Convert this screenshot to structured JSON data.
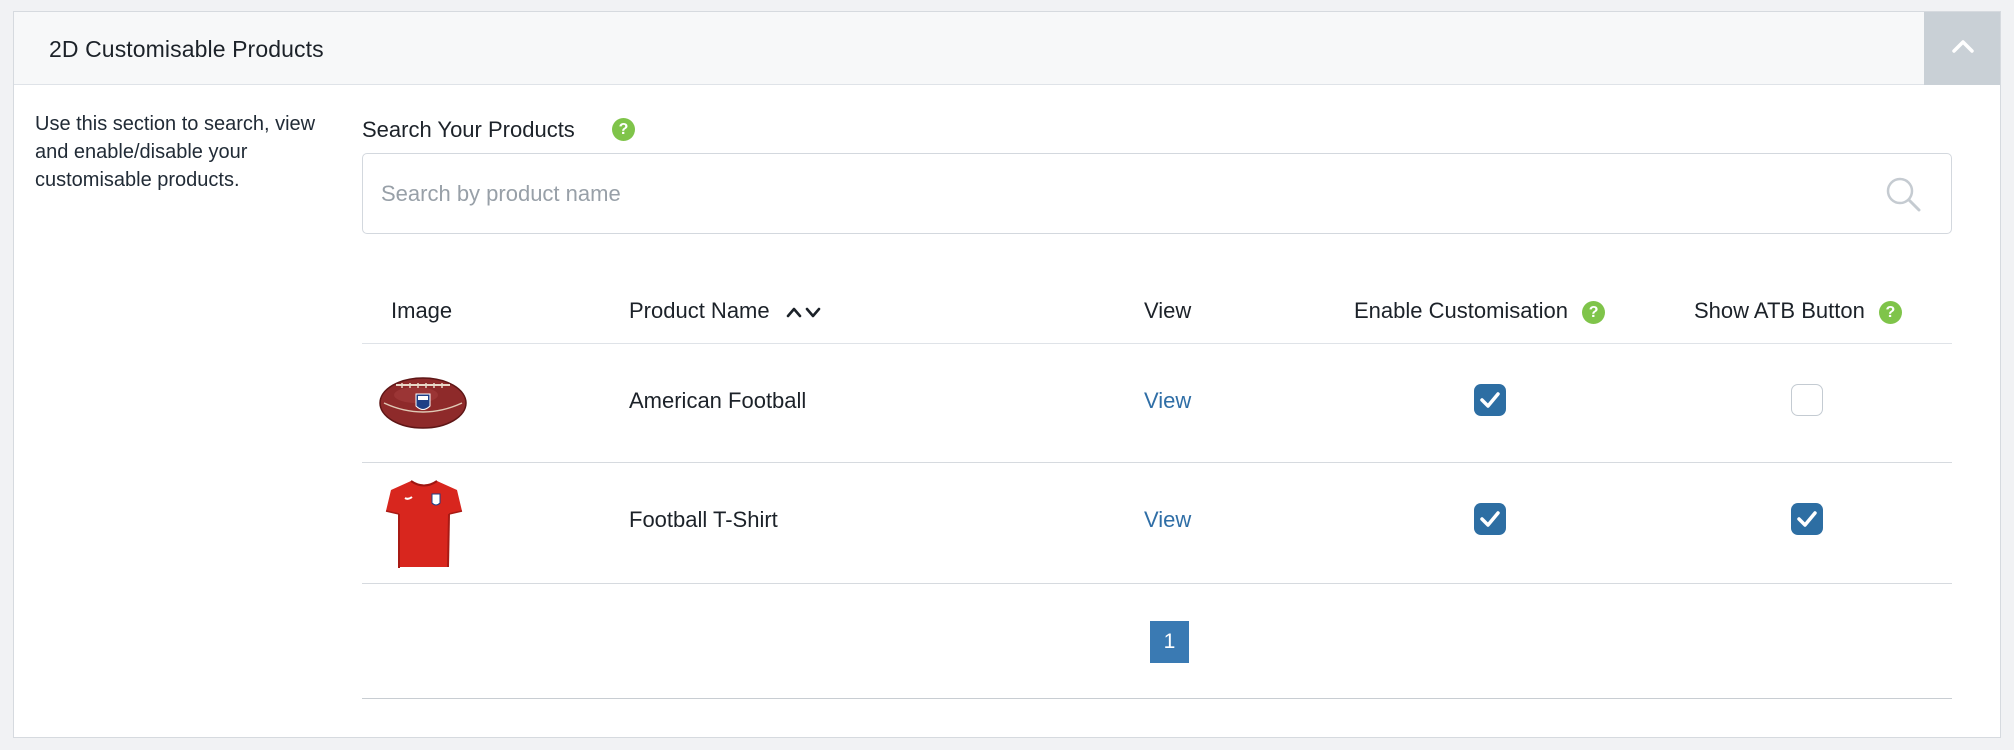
{
  "panel": {
    "title": "2D Customisable Products",
    "collapse_icon": "chevron-up-icon"
  },
  "description": "Use this section to search, view and enable/disable your customisable products.",
  "search": {
    "label": "Search Your Products",
    "help_icon": "question-mark",
    "placeholder": "Search by product name",
    "value": "",
    "icon": "search-icon"
  },
  "table": {
    "columns": {
      "image": "Image",
      "product_name": "Product Name",
      "view": "View",
      "enable_customisation": "Enable Customisation",
      "show_atb": "Show ATB Button"
    },
    "help_glyph": "?",
    "rows": [
      {
        "image_icon": "american-football-image",
        "name": "American Football",
        "view_label": "View",
        "enable_customisation": true,
        "show_atb": false
      },
      {
        "image_icon": "t-shirt-image",
        "name": "Football T-Shirt",
        "view_label": "View",
        "enable_customisation": true,
        "show_atb": true
      }
    ]
  },
  "pagination": {
    "current_page": "1"
  },
  "colors": {
    "accent": "#3a7ab3",
    "checkbox_on": "#2d6ea3",
    "help_green": "#7fc44a",
    "link": "#2f6ea6"
  }
}
